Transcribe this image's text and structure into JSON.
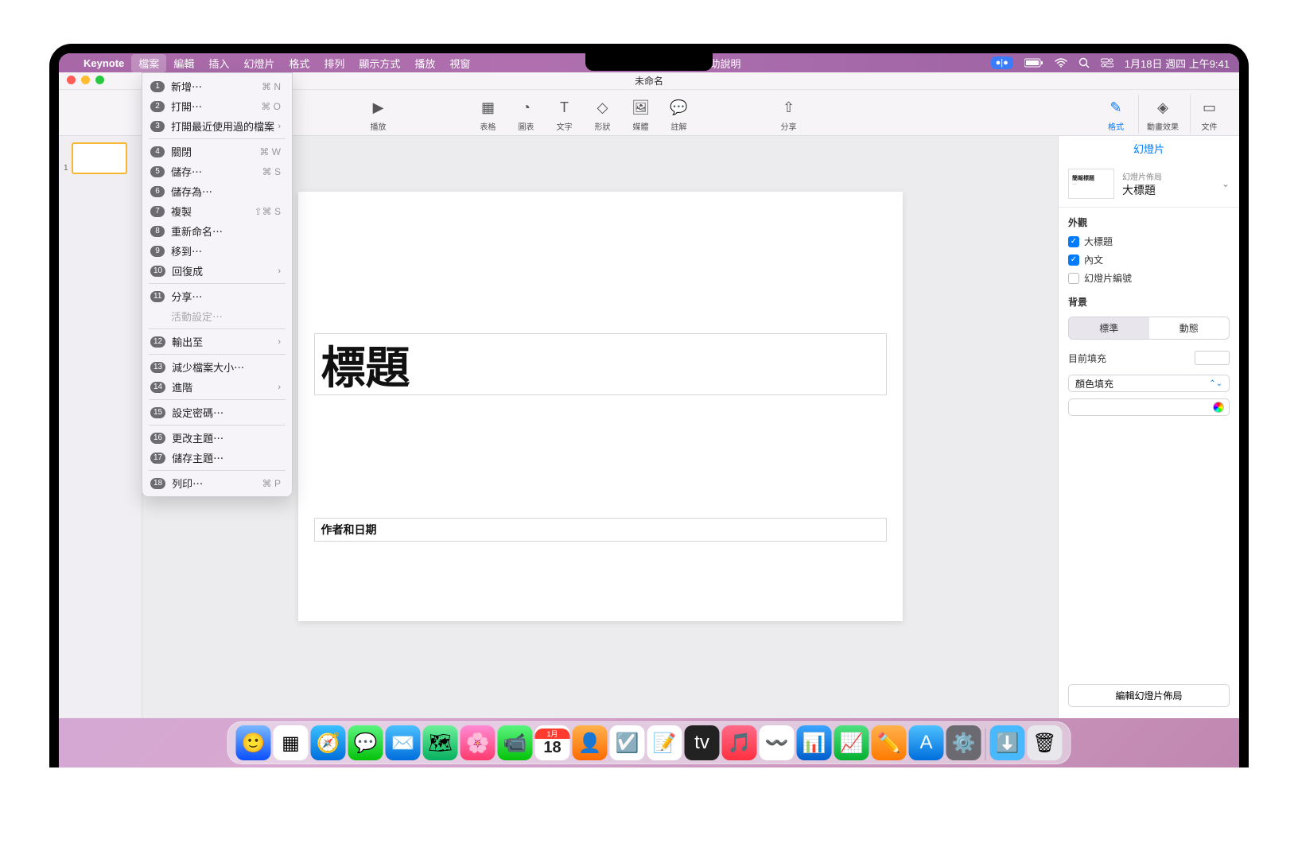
{
  "menubar": {
    "app": "Keynote",
    "items": [
      "檔案",
      "編輯",
      "插入",
      "幻燈片",
      "格式",
      "排列",
      "顯示方式",
      "播放",
      "視窗"
    ],
    "help": "輔助說明",
    "datetime": "1月18日 週四 上午9:41"
  },
  "window": {
    "title": "未命名"
  },
  "toolbar": {
    "play": "播放",
    "table": "表格",
    "chart": "圖表",
    "text": "文字",
    "shape": "形狀",
    "media": "媒體",
    "comment": "註解",
    "share": "分享",
    "format": "格式",
    "animate": "動畫效果",
    "document": "文件"
  },
  "nav": {
    "slide_index": "1",
    "badges": [
      "1",
      "2",
      "3",
      "4",
      "5",
      "6",
      "7",
      "8",
      "9",
      "10",
      "11",
      "12",
      "13",
      "14",
      "15",
      "16",
      "17",
      "18"
    ]
  },
  "file_menu": [
    {
      "label": "新增⋯",
      "shortcut": "⌘ N",
      "badge": "1"
    },
    {
      "label": "打開⋯",
      "shortcut": "⌘ O",
      "badge": "2"
    },
    {
      "label": "打開最近使用過的檔案",
      "submenu": true,
      "badge": "3"
    },
    {
      "sep": true
    },
    {
      "label": "關閉",
      "shortcut": "⌘ W",
      "badge": "4"
    },
    {
      "label": "儲存⋯",
      "shortcut": "⌘ S",
      "badge": "5"
    },
    {
      "label": "儲存為⋯",
      "badge": "6"
    },
    {
      "label": "複製",
      "shortcut": "⇧⌘ S",
      "badge": "7"
    },
    {
      "label": "重新命名⋯",
      "badge": "8"
    },
    {
      "label": "移到⋯",
      "badge": "9"
    },
    {
      "label": "回復成",
      "submenu": true,
      "badge": "10"
    },
    {
      "sep": true
    },
    {
      "label": "分享⋯",
      "badge": "11"
    },
    {
      "label": "活動設定⋯",
      "disabled": true
    },
    {
      "sep": true
    },
    {
      "label": "輸出至",
      "submenu": true,
      "badge": "12"
    },
    {
      "sep": true
    },
    {
      "label": "減少檔案大小⋯",
      "badge": "13"
    },
    {
      "label": "進階",
      "submenu": true,
      "badge": "14"
    },
    {
      "sep": true
    },
    {
      "label": "設定密碼⋯",
      "badge": "15"
    },
    {
      "sep": true
    },
    {
      "label": "更改主題⋯",
      "badge": "16"
    },
    {
      "label": "儲存主題⋯",
      "badge": "17"
    },
    {
      "sep": true
    },
    {
      "label": "列印⋯",
      "shortcut": "⌘ P",
      "badge": "18"
    }
  ],
  "slide": {
    "title_placeholder": "標題",
    "author_placeholder": "作者和日期"
  },
  "inspector": {
    "tab": "幻燈片",
    "layout_label": "幻燈片佈局",
    "layout_name": "大標題",
    "appearance": "外觀",
    "check_title": "大標題",
    "check_body": "內文",
    "check_number": "幻燈片編號",
    "background": "背景",
    "seg_standard": "標準",
    "seg_dynamic": "動態",
    "current_fill": "目前填充",
    "fill_type": "顏色填充",
    "edit_layout": "編輯幻燈片佈局"
  },
  "dock": {
    "cal_month": "1月",
    "cal_day": "18"
  }
}
